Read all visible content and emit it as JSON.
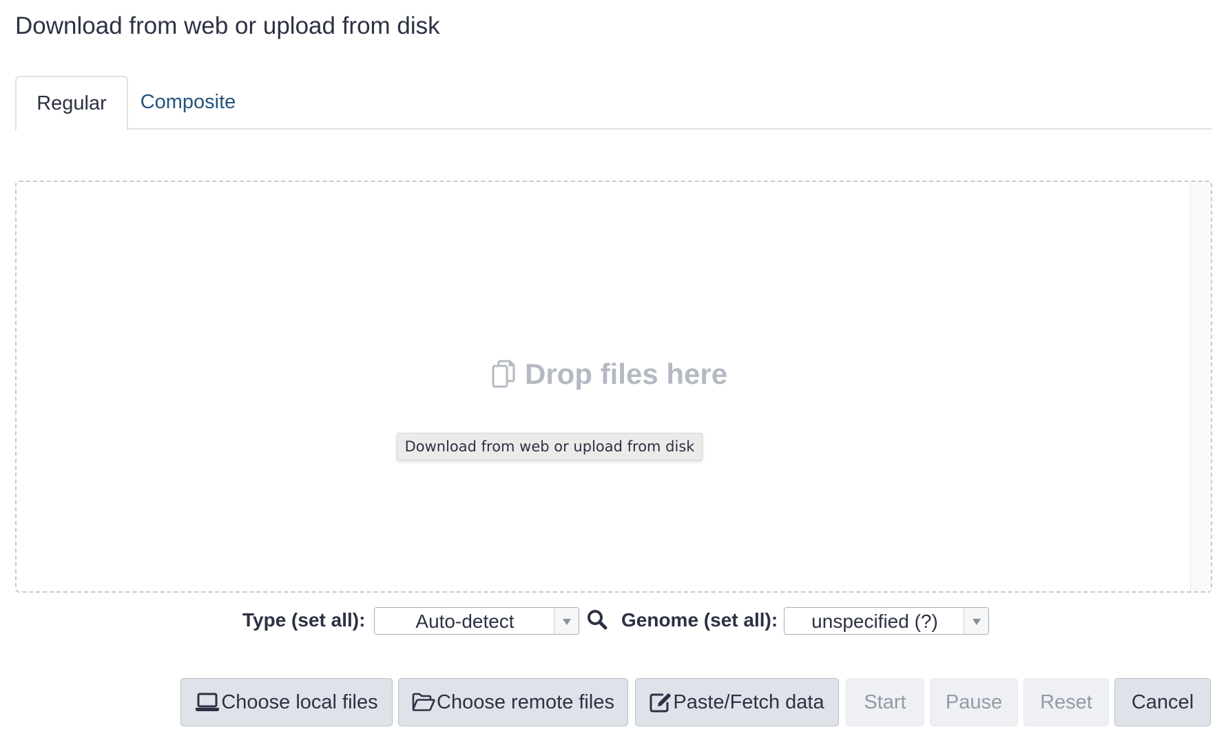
{
  "dialog": {
    "title": "Download from web or upload from disk"
  },
  "tabs": [
    {
      "label": "Regular",
      "active": true
    },
    {
      "label": "Composite",
      "active": false
    }
  ],
  "dropzone": {
    "label": "Drop files here",
    "icon": "copy-icon",
    "tooltip": "Download from web or upload from disk"
  },
  "settings": {
    "type_label": "Type (set all):",
    "type_value": "Auto-detect",
    "genome_label": "Genome (set all):",
    "genome_value": "unspecified (?)"
  },
  "buttons": {
    "choose_local": {
      "label": "Choose local files",
      "icon": "laptop-icon",
      "enabled": true
    },
    "choose_remote": {
      "label": "Choose remote files",
      "icon": "folder-open-icon",
      "enabled": true
    },
    "paste_fetch": {
      "label": "Paste/Fetch data",
      "icon": "edit-icon",
      "enabled": true
    },
    "start": {
      "label": "Start",
      "enabled": false
    },
    "pause": {
      "label": "Pause",
      "enabled": false
    },
    "reset": {
      "label": "Reset",
      "enabled": false
    },
    "cancel": {
      "label": "Cancel",
      "enabled": true
    }
  },
  "colors": {
    "text": "#2c3143",
    "link": "#25537b",
    "placeholder": "#b4b9c3",
    "button_bg": "#dee3ea",
    "disabled_text": "#939aa6"
  }
}
